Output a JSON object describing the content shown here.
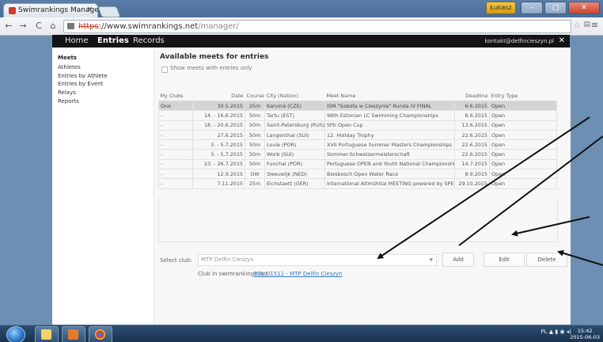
{
  "browser": {
    "tab_title": "Swimrankings Manager",
    "tab_close": "×",
    "url_protocol": "https",
    "url_host": "://www.swimrankings.net",
    "url_path": "/manager/",
    "user_badge": "Łukasz",
    "nav_back": "←",
    "nav_forward": "→",
    "nav_reload": "C",
    "nav_home": "⌂",
    "star_icon": "☆",
    "menu_icon": "≡"
  },
  "topnav": {
    "items": [
      "Home",
      "Entries",
      "Records"
    ],
    "active": "Entries",
    "email": "kontakt@delfincieszyn.pl",
    "close": "✕"
  },
  "sidebar": {
    "heading": "Meets",
    "items": [
      "Athletes",
      "Entries by Athlete",
      "Entries by Event",
      "Relays",
      "Reports"
    ]
  },
  "main": {
    "title": "Available meets for entries",
    "checkbox_label": "Show meets with entries only",
    "columns": [
      "My Clubs",
      "Date",
      "Course",
      "City (Nation)",
      "Meet Name",
      "Deadline",
      "Entry Type"
    ],
    "rows": [
      [
        "One",
        "30.5.2015",
        "25m",
        "Karviná (CZE)",
        "ISM \"Sobota w Cieszynie\" Runda IV FINAL",
        "6.6.2015",
        "Open"
      ],
      [
        "-",
        "14. - 16.6.2015",
        "50m",
        "Tartu (EST)",
        "96th Estonian LC Swimming Championships",
        "8.6.2015",
        "Open"
      ],
      [
        "-",
        "18. - 20.6.2015",
        "50m",
        "Saint-Petersburg (RUS)",
        "SPb Open Cup",
        "13.6.2015",
        "Open"
      ],
      [
        "-",
        "27.6.2015",
        "50m",
        "Langenthal (SUI)",
        "12. Holiday Trophy",
        "22.6.2015",
        "Open"
      ],
      [
        "-",
        "3. - 5.7.2015",
        "50m",
        "Loule (POR)",
        "XVII Portuguese Summer Masters Championships",
        "22.6.2015",
        "Open"
      ],
      [
        "-",
        "3. - 5.7.2015",
        "50m",
        "Worb (SUI)",
        "Sommer-Schweizermeisterschaft",
        "22.6.2015",
        "Open"
      ],
      [
        "-",
        "23. - 26.7.2015",
        "50m",
        "Funchal (POR)",
        "Portuguese OPEN and Youth National Championships",
        "14.7.2015",
        "Open"
      ],
      [
        "-",
        "12.9.2015",
        "OW",
        "Sleeuwijk (NED)",
        "Biesbosch Open Water Race",
        "8.9.2015",
        "Open"
      ],
      [
        "-",
        "7.11.2015",
        "25m",
        "Eichstaett (GER)",
        "International Altmühltal MEETING powered by SPEEDO",
        "29.10.2015",
        "Open"
      ]
    ],
    "select_club_label": "Select club:",
    "select_club_value": "MTP Delfin Cieszyn",
    "dropdown_caret": "▼",
    "add_button": "Add",
    "edit_button": "Edit",
    "delete_button": "Delete",
    "club_in_label": "Club in swimrankings.net",
    "club_link": "POL.01511 - MTP Delfin Cieszyn"
  },
  "taskbar": {
    "tray_lang": "PL",
    "clock_time": "15:42",
    "clock_date": "2015-06-03"
  },
  "colors": {
    "selected_row": "#d4d4d4",
    "link": "#3b77c4",
    "topnav_bg": "#141414",
    "annotation_arrow": "#111111"
  }
}
